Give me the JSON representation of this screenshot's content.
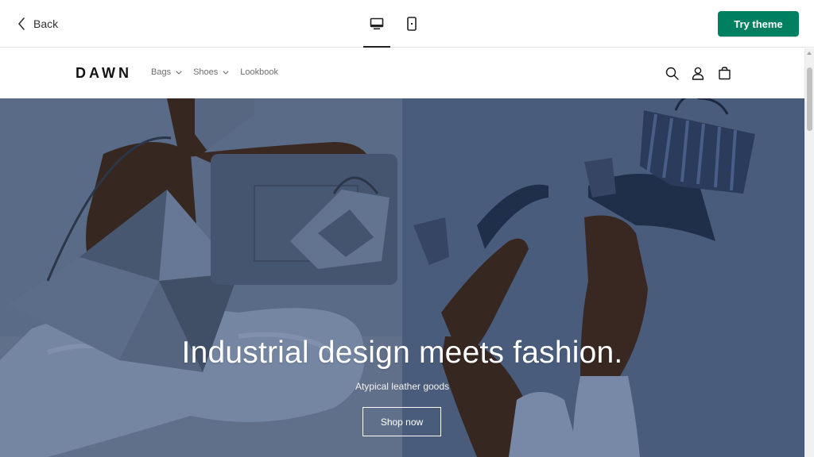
{
  "toolbar": {
    "back_label": "Back",
    "try_theme_label": "Try theme",
    "try_theme_color": "#008060",
    "devices": [
      {
        "name": "desktop",
        "icon": "desktop-icon",
        "active": true
      },
      {
        "name": "mobile",
        "icon": "mobile-icon",
        "active": false
      }
    ]
  },
  "store": {
    "logo": "DAWN",
    "nav": [
      {
        "label": "Bags",
        "has_dropdown": true
      },
      {
        "label": "Shoes",
        "has_dropdown": true
      },
      {
        "label": "Lookbook",
        "has_dropdown": false
      }
    ],
    "header_icons": [
      "search-icon",
      "account-icon",
      "cart-icon"
    ]
  },
  "hero": {
    "heading": "Industrial design meets fashion.",
    "subheading": "Atypical leather goods",
    "button_label": "Shop now",
    "bg_left": "#5f7290",
    "bg_right": "#4f6284"
  }
}
